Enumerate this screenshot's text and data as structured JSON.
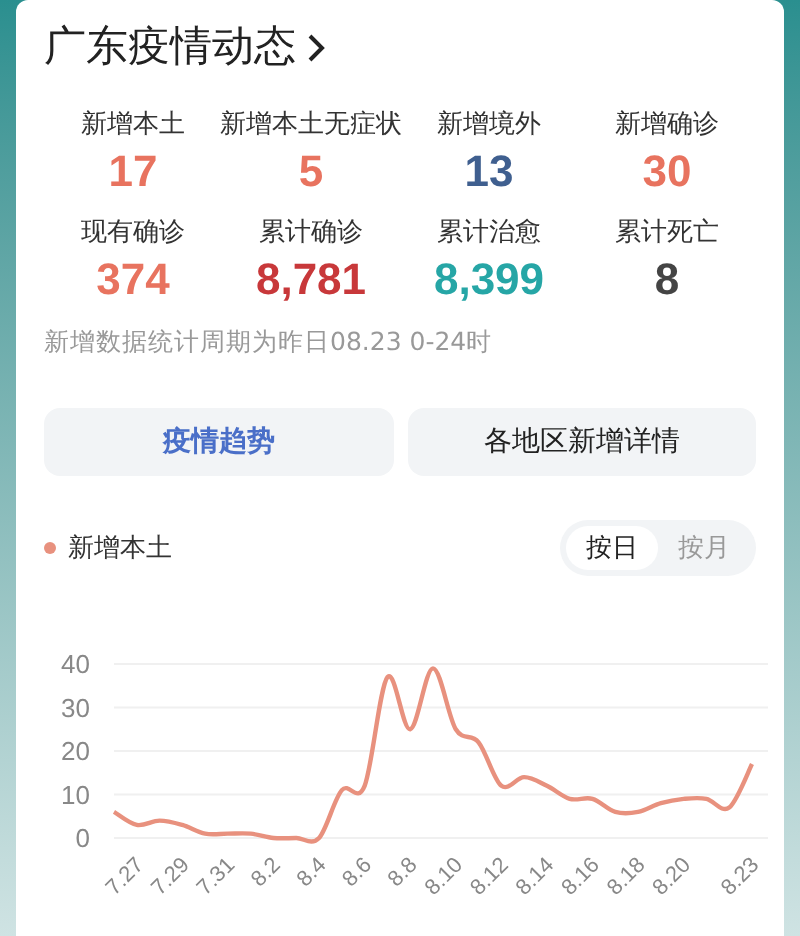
{
  "title": "广东疫情动态",
  "stats": [
    {
      "label": "新增本土",
      "value": "17",
      "color": "#e8735f"
    },
    {
      "label": "新增本土无症状",
      "value": "5",
      "color": "#e8735f"
    },
    {
      "label": "新增境外",
      "value": "13",
      "color": "#3f5f8f"
    },
    {
      "label": "新增确诊",
      "value": "30",
      "color": "#e8735f"
    },
    {
      "label": "现有确诊",
      "value": "374",
      "color": "#e8735f"
    },
    {
      "label": "累计确诊",
      "value": "8,781",
      "color": "#c8383a"
    },
    {
      "label": "累计治愈",
      "value": "8,399",
      "color": "#26a6a6"
    },
    {
      "label": "累计死亡",
      "value": "8",
      "color": "#444444"
    }
  ],
  "note": "新增数据统计周期为昨日08.23 0-24时",
  "tabs": [
    {
      "label": "疫情趋势",
      "selected": true
    },
    {
      "label": "各地区新增详情",
      "selected": false
    }
  ],
  "toggle": [
    {
      "label": "按日",
      "selected": true
    },
    {
      "label": "按月",
      "selected": false
    }
  ],
  "chart_data": {
    "type": "line",
    "categories": [
      null,
      "7.27",
      null,
      "7.29",
      null,
      "7.31",
      null,
      "8.2",
      null,
      "8.4",
      null,
      "8.6",
      null,
      "8.8",
      null,
      "8.10",
      null,
      "8.12",
      null,
      "8.14",
      null,
      "8.16",
      null,
      "8.18",
      null,
      "8.20",
      null,
      null,
      "8.23"
    ],
    "grid": true,
    "series": [
      {
        "name": "新增本土",
        "color": "#e8917e",
        "values": [
          6,
          3,
          4,
          3,
          1,
          1,
          1,
          0,
          0,
          0,
          11,
          12,
          37,
          25,
          39,
          25,
          22,
          12,
          14,
          12,
          9,
          9,
          6,
          6,
          8,
          9,
          9,
          7,
          17
        ]
      }
    ],
    "ylim": [
      0,
      40
    ],
    "yticks": [
      0,
      10,
      20,
      30,
      40
    ]
  }
}
